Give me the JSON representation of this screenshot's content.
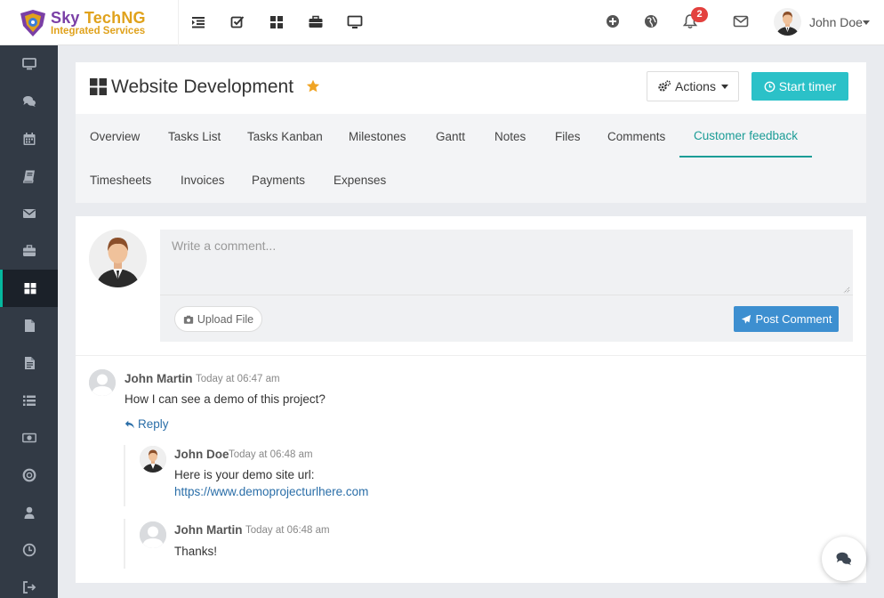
{
  "brand": {
    "name_part1": "Sky ",
    "name_part2": "TechNG",
    "tagline": "Integrated Services",
    "colors": {
      "purple": "#7a3fa6",
      "gold": "#e0a21c"
    }
  },
  "topnav": {
    "icons": [
      "indent-list-icon",
      "checkbox-icon",
      "grid-icon",
      "briefcase-icon",
      "monitor-icon"
    ]
  },
  "header_right": {
    "icons": [
      "plus-circle-icon",
      "globe-icon",
      "bell-icon",
      "envelope-icon"
    ],
    "notification_count": "2",
    "user_name": "John Doe"
  },
  "sidebar": {
    "items": [
      {
        "icon": "monitor-icon",
        "active": false
      },
      {
        "icon": "comments-icon",
        "active": false
      },
      {
        "icon": "calendar-icon",
        "active": false
      },
      {
        "icon": "book-icon",
        "active": false
      },
      {
        "icon": "envelope-icon",
        "active": false
      },
      {
        "icon": "briefcase-icon",
        "active": false
      },
      {
        "icon": "grid-icon",
        "active": true
      },
      {
        "icon": "file-icon",
        "active": false
      },
      {
        "icon": "file-text-icon",
        "active": false
      },
      {
        "icon": "list-icon",
        "active": false
      },
      {
        "icon": "money-icon",
        "active": false
      },
      {
        "icon": "life-ring-icon",
        "active": false
      },
      {
        "icon": "user-icon",
        "active": false
      },
      {
        "icon": "clock-icon",
        "active": false
      },
      {
        "icon": "sign-out-icon",
        "active": false
      }
    ]
  },
  "project": {
    "title": "Website Development",
    "actions_label": "Actions",
    "timer_label": "Start timer"
  },
  "tabs": [
    {
      "label": "Overview"
    },
    {
      "label": "Tasks List"
    },
    {
      "label": "Tasks Kanban"
    },
    {
      "label": "Milestones"
    },
    {
      "label": "Gantt"
    },
    {
      "label": "Notes"
    },
    {
      "label": "Files"
    },
    {
      "label": "Comments"
    },
    {
      "label": "Customer feedback",
      "active": true
    },
    {
      "label": "Timesheets"
    },
    {
      "label": "Invoices"
    },
    {
      "label": "Payments"
    },
    {
      "label": "Expenses"
    }
  ],
  "composer": {
    "placeholder": "Write a comment...",
    "upload_label": "Upload File",
    "post_label": "Post Comment"
  },
  "comments": [
    {
      "author": "John Martin",
      "time": "Today at 06:47 am",
      "text": "How I can see a demo of this project?",
      "reply_label": "Reply",
      "replies": [
        {
          "author": "John Doe",
          "time": "Today at 06:48 am",
          "text": "Here is your demo site url:",
          "link": "https://www.demoprojecturlhere.com"
        },
        {
          "author": "John Martin",
          "time": "Today at 06:48 am",
          "text": "Thanks!"
        }
      ]
    }
  ],
  "colors": {
    "sidebar_bg": "#323a45",
    "accent_teal": "#1b9c96",
    "timer_button": "#2bc1c8",
    "post_button": "#3d8fd0",
    "badge_red": "#e3413e"
  }
}
